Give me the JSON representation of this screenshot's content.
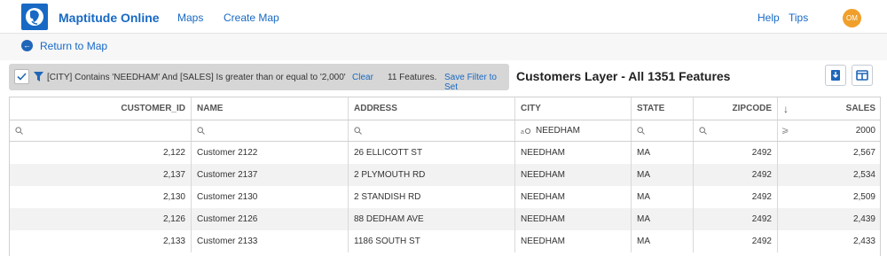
{
  "app": {
    "name": "Maptitude Online",
    "nav": [
      "Maps",
      "Create Map"
    ],
    "right_links": [
      "Help",
      "Tips"
    ],
    "user_initials": "OM"
  },
  "return_link": "Return to Map",
  "filter": {
    "expression": "[CITY] Contains 'NEEDHAM' And [SALES] Is greater than or equal to '2,000'",
    "clear_label": "Clear",
    "feature_count": "11 Features.",
    "save_label": "Save Filter to Set"
  },
  "layer_title": "Customers Layer - All 1351 Features",
  "toolbar": {
    "export_icon": "download-icon",
    "columns_icon": "columns-icon"
  },
  "table": {
    "columns": [
      "CUSTOMER_ID",
      "NAME",
      "ADDRESS",
      "CITY",
      "STATE",
      "ZIPCODE",
      "SALES"
    ],
    "sort_indicator": "↓",
    "filters": {
      "city": "NEEDHAM",
      "sales_symbol": "⩾",
      "sales": "2000"
    },
    "rows": [
      [
        "2,122",
        "Customer 2122",
        "26 ELLICOTT ST",
        "NEEDHAM",
        "MA",
        "2492",
        "2,567"
      ],
      [
        "2,137",
        "Customer 2137",
        "2 PLYMOUTH RD",
        "NEEDHAM",
        "MA",
        "2492",
        "2,534"
      ],
      [
        "2,130",
        "Customer 2130",
        "2 STANDISH RD",
        "NEEDHAM",
        "MA",
        "2492",
        "2,509"
      ],
      [
        "2,126",
        "Customer 2126",
        "88 DEDHAM AVE",
        "NEEDHAM",
        "MA",
        "2492",
        "2,439"
      ],
      [
        "2,133",
        "Customer 2133",
        "1186 SOUTH ST",
        "NEEDHAM",
        "MA",
        "2492",
        "2,433"
      ]
    ]
  },
  "colors": {
    "accent": "#1769c4",
    "filter_bar": "#d6d6d6",
    "avatar": "#f0a02a",
    "alt_row": "#f2f2f2"
  }
}
